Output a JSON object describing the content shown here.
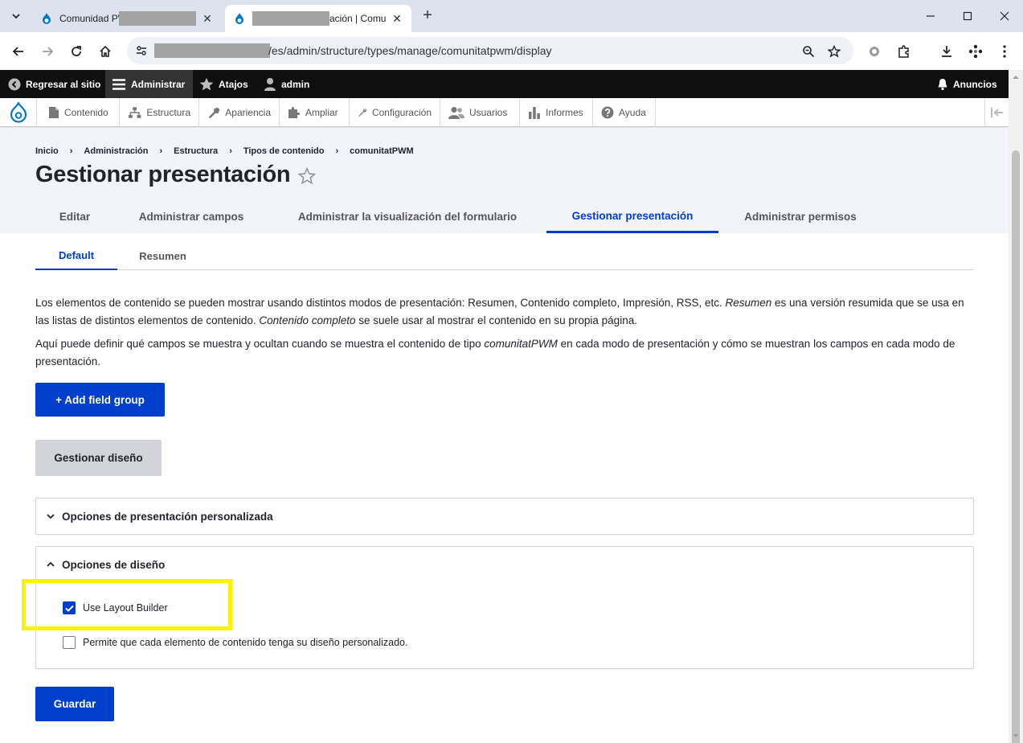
{
  "browser": {
    "tabs": [
      {
        "title": "Comunidad PW",
        "active": false
      },
      {
        "title_suffix": "ación | Comu",
        "active": true
      }
    ],
    "url_path": "/es/admin/structure/types/manage/comunitatpwm/display",
    "new_tab_label": "+",
    "close_glyph": "✕"
  },
  "admin_bar": {
    "back_label": "Regresar al sitio",
    "manage_label": "Administrar",
    "shortcuts_label": "Atajos",
    "user_label": "admin",
    "announcements_label": "Anuncios"
  },
  "tray": {
    "items": [
      {
        "label": "Contenido",
        "icon": "content-icon"
      },
      {
        "label": "Estructura",
        "icon": "structure-icon"
      },
      {
        "label": "Apariencia",
        "icon": "appearance-icon"
      },
      {
        "label": "Ampliar",
        "icon": "extend-icon"
      },
      {
        "label": "Configuración",
        "icon": "config-icon"
      },
      {
        "label": "Usuarios",
        "icon": "people-icon"
      },
      {
        "label": "Informes",
        "icon": "reports-icon"
      },
      {
        "label": "Ayuda",
        "icon": "help-icon"
      }
    ]
  },
  "breadcrumb": [
    "Inicio",
    "Administración",
    "Estructura",
    "Tipos de contenido",
    "comunitatPWM"
  ],
  "breadcrumb_sep": "›",
  "page_title": "Gestionar presentación",
  "primary_tabs": [
    "Editar",
    "Administrar campos",
    "Administrar la visualización del formulario",
    "Gestionar presentación",
    "Administrar permisos"
  ],
  "secondary_tabs": [
    "Default",
    "Resumen"
  ],
  "description": {
    "p1_a": "Los elementos de contenido se pueden mostrar usando distintos modos de presentación: Resumen, Contenido completo, Impresión, RSS, etc. ",
    "p1_em1": "Resumen",
    "p1_b": " es una versión resumida que se usa en las listas de distintos elementos de contenido. ",
    "p1_em2": "Contenido completo",
    "p1_c": " se suele usar al mostrar el contenido en su propia página.",
    "p2_a": "Aquí puede definir qué campos se muestra y ocultan cuando se muestra el contenido de tipo ",
    "p2_em": "comunitatPWM",
    "p2_b": " en cada modo de presentación y cómo se muestran los campos en cada modo de presentación."
  },
  "buttons": {
    "add_field_group": "+ Add field group",
    "manage_layout": "Gestionar diseño",
    "save": "Guardar"
  },
  "sections": {
    "custom_display": "Opciones de presentación personalizada",
    "layout_options": "Opciones de diseño"
  },
  "checkboxes": {
    "use_layout_builder": {
      "label": "Use Layout Builder",
      "checked": true
    },
    "allow_custom": {
      "label": "Permite que cada elemento de contenido tenga su diseño personalizado.",
      "checked": false
    }
  },
  "colors": {
    "primary": "#003ecc",
    "highlight": "#fbf400",
    "admin_bar": "#0f0f0f"
  }
}
